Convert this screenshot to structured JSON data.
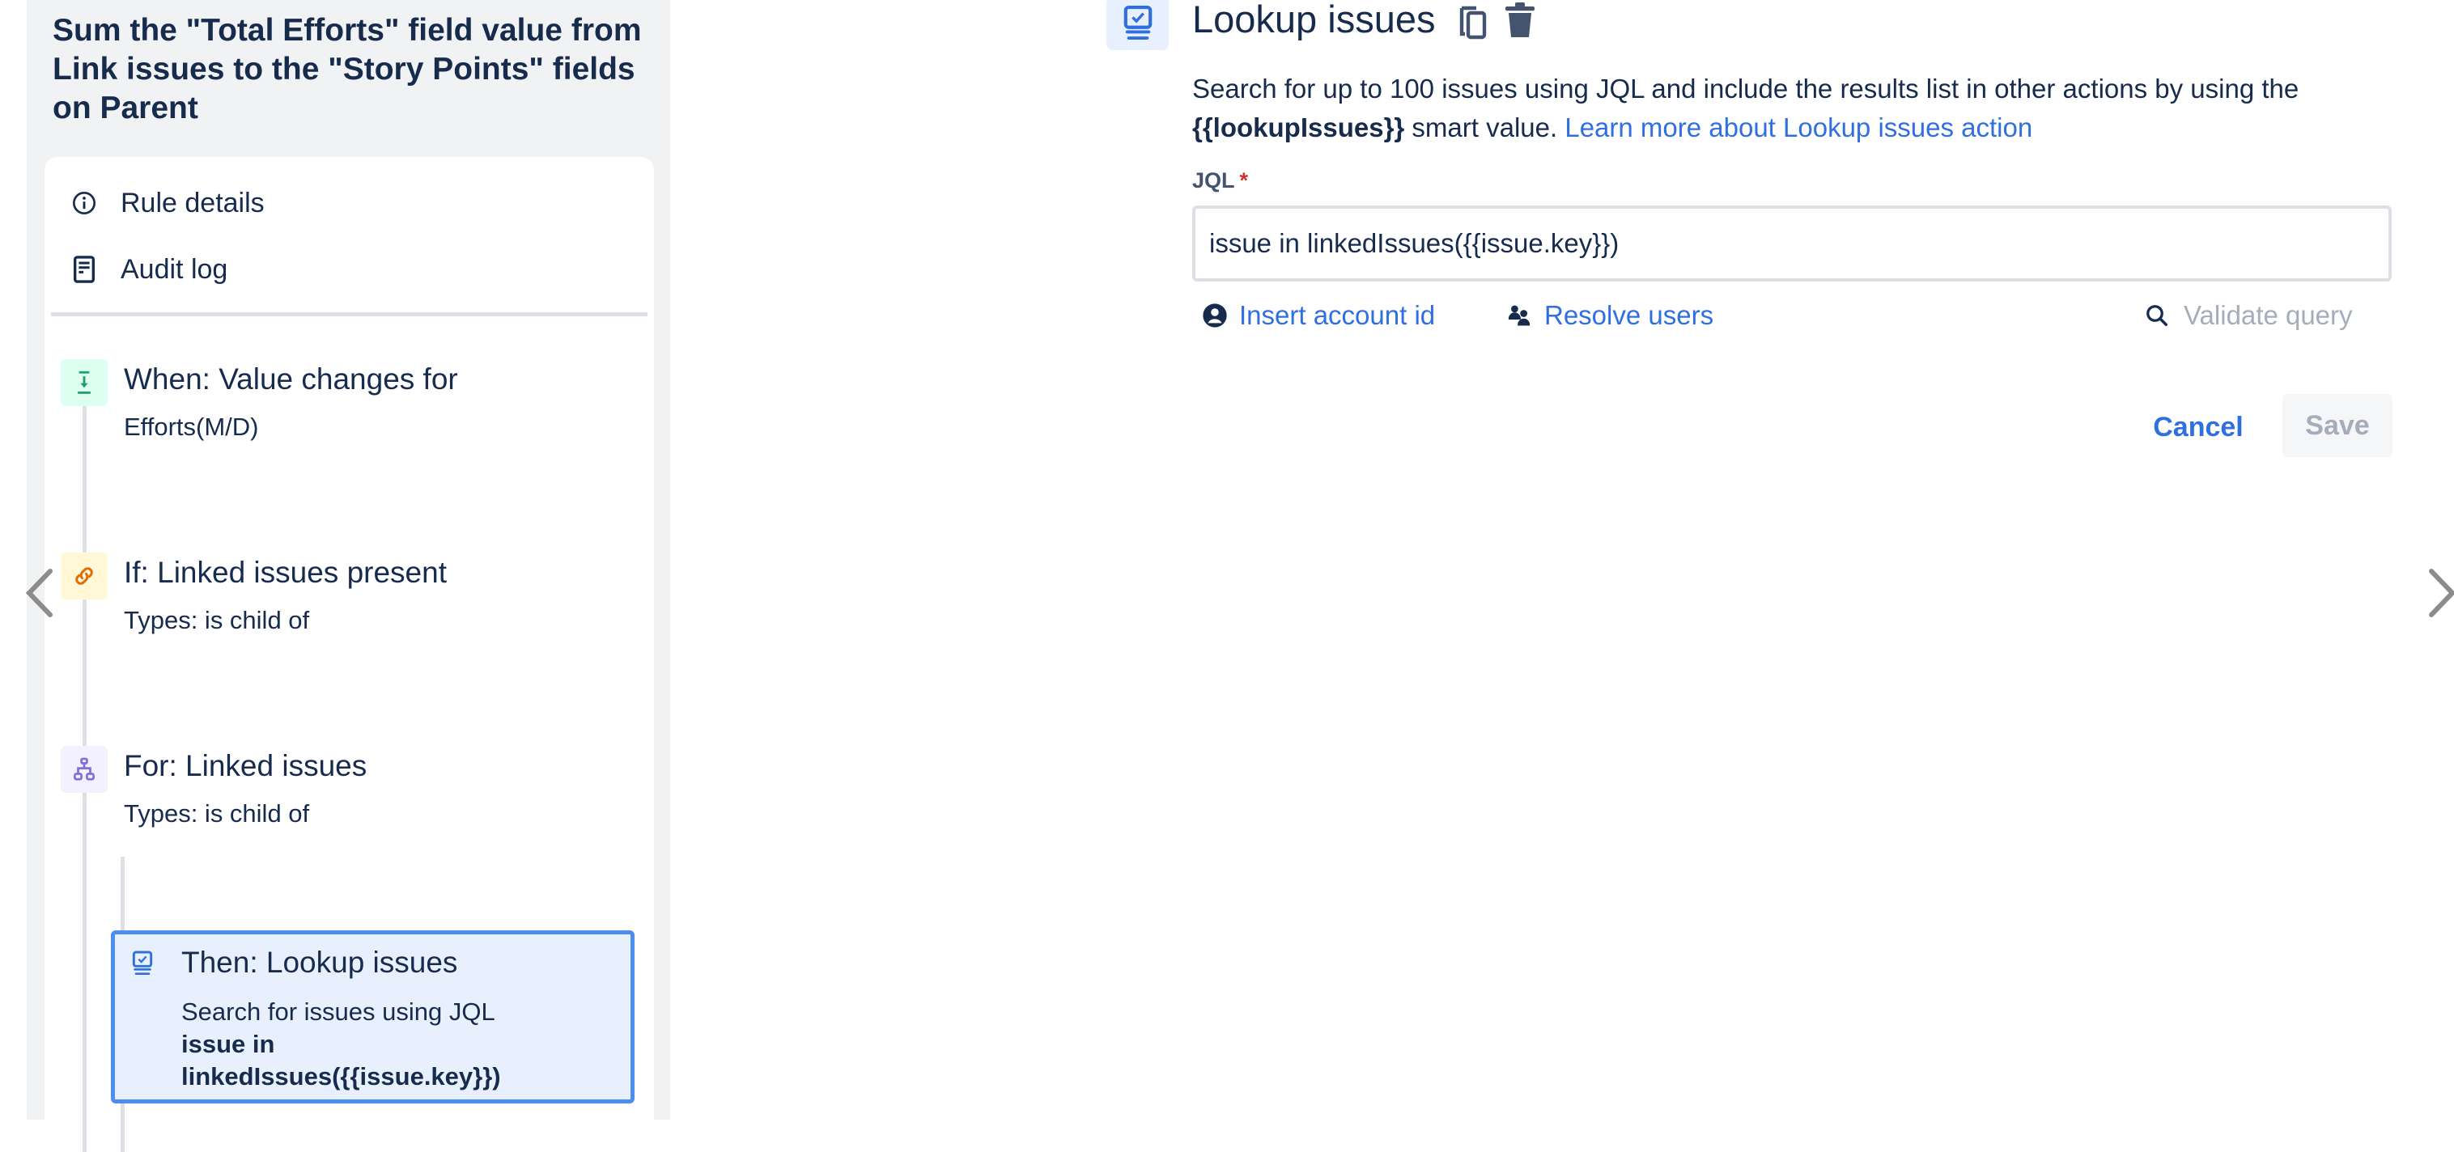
{
  "sidebar": {
    "rule_title": "Sum the \"Total Efforts\" field value from Link issues to the \"Story Points\" fields on Parent",
    "menu": [
      {
        "label": "Rule details",
        "icon": "info-icon"
      },
      {
        "label": "Audit log",
        "icon": "document-icon"
      }
    ],
    "steps": [
      {
        "title": "When: Value changes for",
        "subtitle": "Efforts(M/D)",
        "icon": "trigger-icon",
        "color": "#22a06b",
        "bg": "#dcfff1"
      },
      {
        "title": "If: Linked issues present",
        "subtitle": "Types: is child of",
        "icon": "link-icon",
        "color": "#e06c00",
        "bg": "#fff7d6"
      },
      {
        "title": "For: Linked issues",
        "subtitle": "Types: is child of",
        "icon": "branch-icon",
        "color": "#8270db",
        "bg": "#f3f0ff"
      }
    ],
    "selected_step": {
      "title": "Then: Lookup issues",
      "description": "Search for issues using JQL",
      "jql": "issue in linkedIssues({{issue.key}})",
      "icon": "lookup-issues-icon"
    }
  },
  "nav": {
    "prev_icon": "chevron-left-icon",
    "next_icon": "chevron-right-icon"
  },
  "action": {
    "title": "Lookup issues",
    "icon": "lookup-issues-icon",
    "copy_icon": "copy-icon",
    "delete_icon": "trash-icon",
    "description_prefix": "Search for up to 100 issues using JQL and include the results list in other actions by using the ",
    "smart_value": "{{lookupIssues}}",
    "description_suffix": " smart value. ",
    "learn_more": "Learn more about Lookup issues action",
    "jql_label": "JQL",
    "required_marker": "*",
    "jql_value": "issue in linkedIssues({{issue.key}})",
    "insert_account_id": "Insert account id",
    "resolve_users": "Resolve users",
    "validate_query": "Validate query",
    "cancel": "Cancel",
    "save": "Save"
  },
  "colors": {
    "accent": "#2f6fe0",
    "selected_border": "#4c8ef0",
    "selected_bg": "#e9f0fd",
    "text": "#172b4d",
    "disabled": "#a5adba",
    "required": "#c9372c"
  }
}
